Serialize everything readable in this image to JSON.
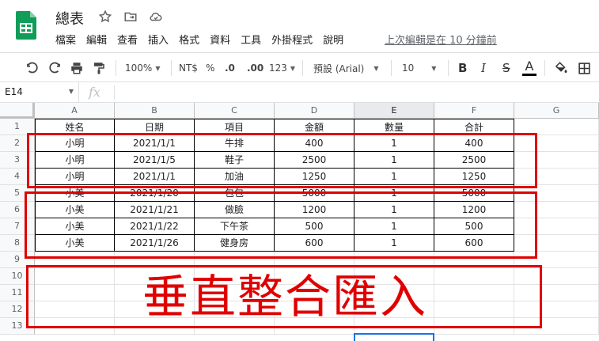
{
  "app": {
    "title": "總表",
    "menu": [
      "檔案",
      "編輯",
      "查看",
      "插入",
      "格式",
      "資料",
      "工具",
      "外掛程式",
      "說明"
    ],
    "last_edit": "上次編輯是在 10 分鐘前"
  },
  "toolbar": {
    "zoom": "100%",
    "currency": "NT$",
    "percent": "%",
    "dec_decrease": ".0",
    "dec_increase": ".00",
    "number_format": "123",
    "font": "預設 (Arial)",
    "font_size": "10",
    "bold": "B",
    "italic": "I",
    "strike": "S",
    "text_color": "A"
  },
  "formula_bar": {
    "cell_ref": "E14",
    "fx": "fx"
  },
  "columns": [
    "A",
    "B",
    "C",
    "D",
    "E",
    "F",
    "G"
  ],
  "rows": [
    "1",
    "2",
    "3",
    "4",
    "5",
    "6",
    "7",
    "8",
    "9",
    "10",
    "11",
    "12",
    "13"
  ],
  "selected_column": "E",
  "table": {
    "headers": [
      "姓名",
      "日期",
      "項目",
      "金額",
      "數量",
      "合計"
    ],
    "data": [
      [
        "小明",
        "2021/1/1",
        "牛排",
        "400",
        "1",
        "400"
      ],
      [
        "小明",
        "2021/1/5",
        "鞋子",
        "2500",
        "1",
        "2500"
      ],
      [
        "小明",
        "2021/1/1",
        "加油",
        "1250",
        "1",
        "1250"
      ],
      [
        "小美",
        "2021/1/20",
        "包包",
        "5000",
        "1",
        "5000"
      ],
      [
        "小美",
        "2021/1/21",
        "做臉",
        "1200",
        "1",
        "1200"
      ],
      [
        "小美",
        "2021/1/22",
        "下午茶",
        "500",
        "1",
        "500"
      ],
      [
        "小美",
        "2021/1/26",
        "健身房",
        "600",
        "1",
        "600"
      ]
    ]
  },
  "annotation": "垂直整合匯入",
  "colors": {
    "accent_red": "#e00000",
    "selection_blue": "#1a73e8",
    "sheets_green": "#0f9d58"
  }
}
